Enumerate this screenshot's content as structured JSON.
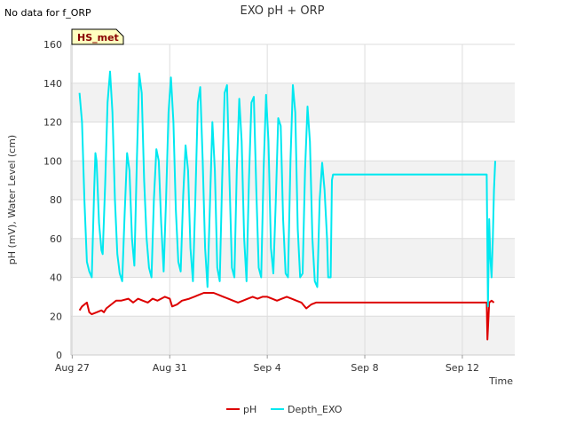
{
  "notice": "No data for f_ORP",
  "badge": "HS_met",
  "chart_data": {
    "type": "line",
    "title": "EXO pH + ORP",
    "xlabel": "Time",
    "ylabel": "pH (mV), Water Level (cm)",
    "ylim": [
      0,
      160
    ],
    "yticks": [
      0,
      20,
      40,
      60,
      80,
      100,
      120,
      140,
      160
    ],
    "xlim_days": [
      -0.05,
      18.15
    ],
    "xticks": [
      {
        "label": "Aug 27",
        "day": 0
      },
      {
        "label": "Aug 31",
        "day": 4
      },
      {
        "label": "Sep 4",
        "day": 8
      },
      {
        "label": "Sep 8",
        "day": 12
      },
      {
        "label": "Sep 12",
        "day": 16
      }
    ],
    "grid": true,
    "legend_position": "bottom",
    "series": [
      {
        "name": "pH",
        "color": "#dd0000",
        "points": [
          [
            0.3,
            23
          ],
          [
            0.4,
            25
          ],
          [
            0.6,
            27
          ],
          [
            0.7,
            22
          ],
          [
            0.8,
            21
          ],
          [
            1.0,
            22
          ],
          [
            1.2,
            23
          ],
          [
            1.3,
            22
          ],
          [
            1.4,
            24
          ],
          [
            1.6,
            26
          ],
          [
            1.8,
            28
          ],
          [
            2.0,
            28
          ],
          [
            2.3,
            29
          ],
          [
            2.5,
            27
          ],
          [
            2.7,
            29
          ],
          [
            2.9,
            28
          ],
          [
            3.1,
            27
          ],
          [
            3.3,
            29
          ],
          [
            3.5,
            28
          ],
          [
            3.8,
            30
          ],
          [
            4.0,
            29
          ],
          [
            4.1,
            25
          ],
          [
            4.3,
            26
          ],
          [
            4.5,
            28
          ],
          [
            4.8,
            29
          ],
          [
            5.0,
            30
          ],
          [
            5.2,
            31
          ],
          [
            5.4,
            32
          ],
          [
            5.6,
            32
          ],
          [
            5.8,
            32
          ],
          [
            6.0,
            31
          ],
          [
            6.2,
            30
          ],
          [
            6.4,
            29
          ],
          [
            6.6,
            28
          ],
          [
            6.8,
            27
          ],
          [
            7.0,
            28
          ],
          [
            7.2,
            29
          ],
          [
            7.4,
            30
          ],
          [
            7.6,
            29
          ],
          [
            7.8,
            30
          ],
          [
            8.0,
            30
          ],
          [
            8.2,
            29
          ],
          [
            8.4,
            28
          ],
          [
            8.6,
            29
          ],
          [
            8.8,
            30
          ],
          [
            9.0,
            29
          ],
          [
            9.2,
            28
          ],
          [
            9.4,
            27
          ],
          [
            9.6,
            24
          ],
          [
            9.8,
            26
          ],
          [
            10.0,
            27
          ],
          [
            10.2,
            27
          ],
          [
            17.0,
            27
          ],
          [
            17.03,
            8
          ],
          [
            17.1,
            27
          ],
          [
            17.2,
            28
          ],
          [
            17.3,
            27
          ]
        ]
      },
      {
        "name": "Depth_EXO",
        "color": "#00e8f0",
        "points": [
          [
            0.3,
            135
          ],
          [
            0.4,
            120
          ],
          [
            0.5,
            80
          ],
          [
            0.6,
            48
          ],
          [
            0.7,
            43
          ],
          [
            0.8,
            40
          ],
          [
            0.9,
            85
          ],
          [
            0.95,
            104
          ],
          [
            1.0,
            100
          ],
          [
            1.1,
            68
          ],
          [
            1.2,
            54
          ],
          [
            1.25,
            52
          ],
          [
            1.35,
            88
          ],
          [
            1.45,
            130
          ],
          [
            1.55,
            146
          ],
          [
            1.65,
            125
          ],
          [
            1.75,
            80
          ],
          [
            1.85,
            52
          ],
          [
            1.95,
            42
          ],
          [
            2.05,
            38
          ],
          [
            2.15,
            72
          ],
          [
            2.25,
            104
          ],
          [
            2.35,
            95
          ],
          [
            2.45,
            60
          ],
          [
            2.55,
            46
          ],
          [
            2.65,
            100
          ],
          [
            2.75,
            145
          ],
          [
            2.85,
            135
          ],
          [
            2.95,
            90
          ],
          [
            3.05,
            60
          ],
          [
            3.15,
            45
          ],
          [
            3.25,
            40
          ],
          [
            3.35,
            80
          ],
          [
            3.45,
            106
          ],
          [
            3.55,
            100
          ],
          [
            3.65,
            68
          ],
          [
            3.75,
            43
          ],
          [
            3.85,
            80
          ],
          [
            3.95,
            125
          ],
          [
            4.05,
            143
          ],
          [
            4.15,
            120
          ],
          [
            4.25,
            75
          ],
          [
            4.35,
            48
          ],
          [
            4.45,
            43
          ],
          [
            4.55,
            82
          ],
          [
            4.65,
            108
          ],
          [
            4.75,
            95
          ],
          [
            4.85,
            55
          ],
          [
            4.95,
            38
          ],
          [
            5.05,
            80
          ],
          [
            5.15,
            130
          ],
          [
            5.25,
            138
          ],
          [
            5.35,
            100
          ],
          [
            5.45,
            55
          ],
          [
            5.55,
            35
          ],
          [
            5.65,
            78
          ],
          [
            5.75,
            120
          ],
          [
            5.85,
            95
          ],
          [
            5.95,
            45
          ],
          [
            6.05,
            38
          ],
          [
            6.15,
            90
          ],
          [
            6.25,
            135
          ],
          [
            6.35,
            139
          ],
          [
            6.45,
            90
          ],
          [
            6.55,
            45
          ],
          [
            6.65,
            40
          ],
          [
            6.75,
            95
          ],
          [
            6.85,
            132
          ],
          [
            6.95,
            110
          ],
          [
            7.05,
            60
          ],
          [
            7.15,
            38
          ],
          [
            7.25,
            90
          ],
          [
            7.35,
            130
          ],
          [
            7.45,
            133
          ],
          [
            7.55,
            85
          ],
          [
            7.65,
            45
          ],
          [
            7.75,
            40
          ],
          [
            7.85,
            95
          ],
          [
            7.95,
            134
          ],
          [
            8.05,
            110
          ],
          [
            8.15,
            55
          ],
          [
            8.25,
            42
          ],
          [
            8.35,
            80
          ],
          [
            8.45,
            122
          ],
          [
            8.55,
            118
          ],
          [
            8.65,
            70
          ],
          [
            8.75,
            42
          ],
          [
            8.85,
            40
          ],
          [
            8.95,
            100
          ],
          [
            9.05,
            139
          ],
          [
            9.15,
            125
          ],
          [
            9.25,
            65
          ],
          [
            9.35,
            40
          ],
          [
            9.45,
            42
          ],
          [
            9.55,
            95
          ],
          [
            9.65,
            128
          ],
          [
            9.75,
            110
          ],
          [
            9.85,
            60
          ],
          [
            9.95,
            38
          ],
          [
            10.05,
            35
          ],
          [
            10.15,
            80
          ],
          [
            10.25,
            99
          ],
          [
            10.35,
            85
          ],
          [
            10.45,
            60
          ],
          [
            10.5,
            40
          ],
          [
            10.6,
            40
          ],
          [
            10.65,
            90
          ],
          [
            10.7,
            93
          ],
          [
            17.0,
            93
          ],
          [
            17.05,
            25
          ],
          [
            17.1,
            70
          ],
          [
            17.15,
            50
          ],
          [
            17.2,
            40
          ],
          [
            17.25,
            60
          ],
          [
            17.3,
            85
          ],
          [
            17.35,
            100
          ]
        ]
      }
    ]
  }
}
